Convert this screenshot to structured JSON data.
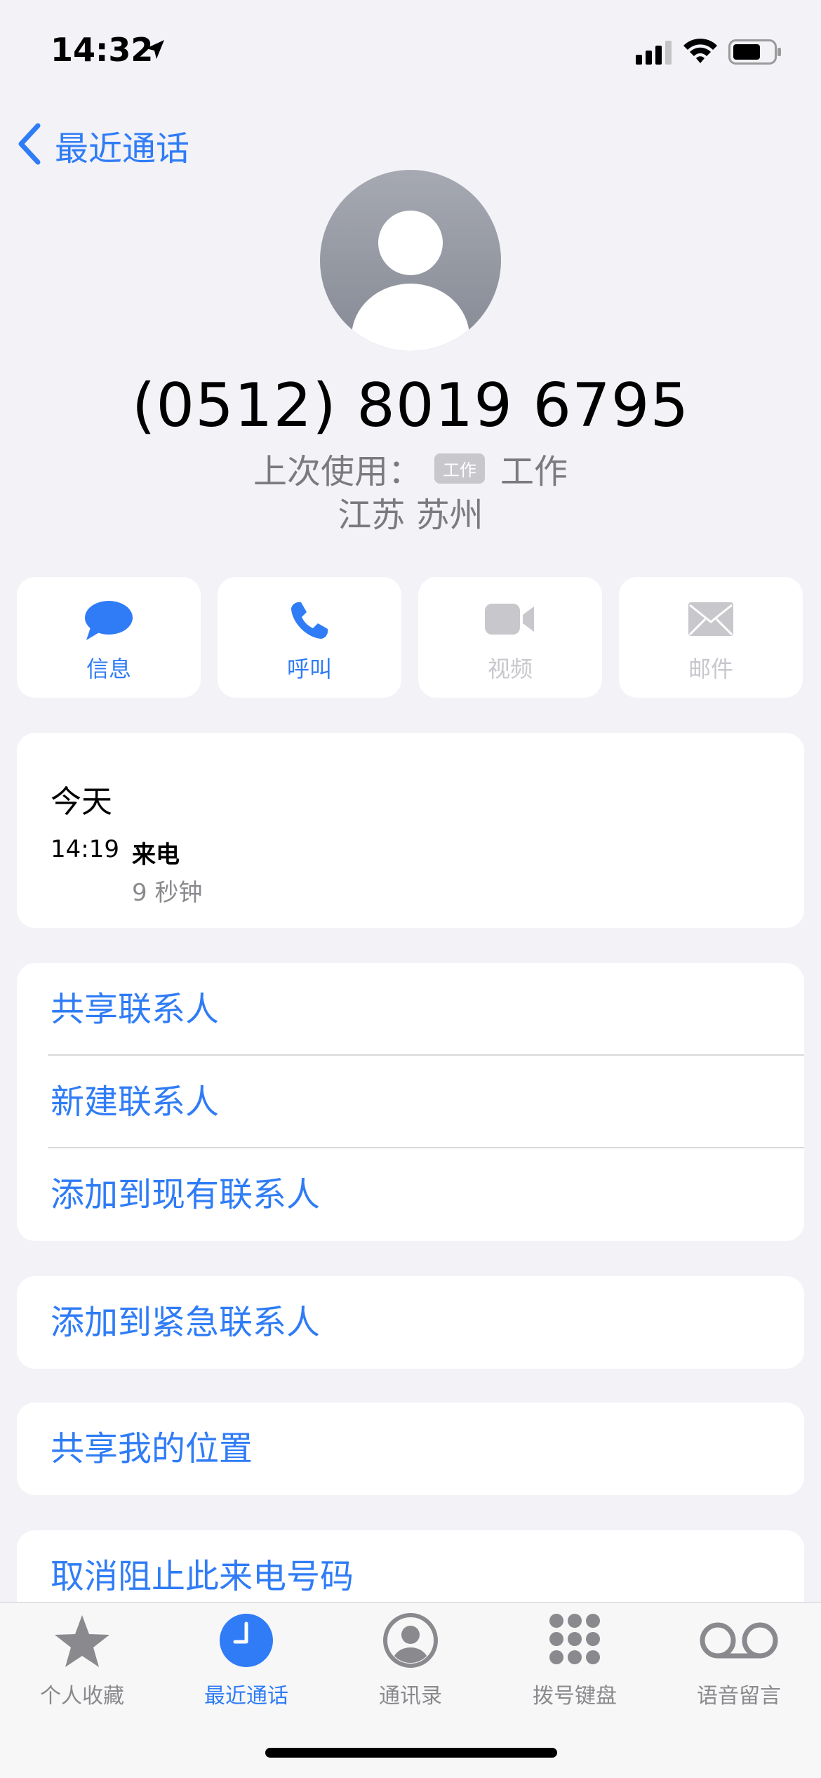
{
  "status_bar": {
    "time": "14:32",
    "icons": [
      "location-arrow-icon",
      "signal-icon",
      "wifi-icon",
      "battery-icon"
    ]
  },
  "nav": {
    "back_label": "最近通话"
  },
  "caller": {
    "number": "(0512) 8019 6795",
    "last_used_prefix": "上次使用：",
    "badge": "工作",
    "last_used_value": "工作",
    "location": "江苏 苏州"
  },
  "actions": [
    {
      "label": "信息",
      "icon": "message-icon",
      "enabled": true
    },
    {
      "label": "呼叫",
      "icon": "phone-icon",
      "enabled": true
    },
    {
      "label": "视频",
      "icon": "video-icon",
      "enabled": false
    },
    {
      "label": "邮件",
      "icon": "mail-icon",
      "enabled": false
    }
  ],
  "call_history": {
    "day": "今天",
    "time": "14:19",
    "type": "来电",
    "duration": "9 秒钟"
  },
  "contact_actions": [
    "共享联系人",
    "新建联系人",
    "添加到现有联系人"
  ],
  "emergency_action": "添加到紧急联系人",
  "location_action": "共享我的位置",
  "block_action": "取消阻止此来电号码",
  "tabs": [
    {
      "label": "个人收藏",
      "icon": "star-icon",
      "active": false
    },
    {
      "label": "最近通话",
      "icon": "clock-icon",
      "active": true
    },
    {
      "label": "通讯录",
      "icon": "person-circle-icon",
      "active": false
    },
    {
      "label": "拨号键盘",
      "icon": "keypad-icon",
      "active": false
    },
    {
      "label": "语音留言",
      "icon": "voicemail-icon",
      "active": false
    }
  ],
  "colors": {
    "accent": "#2f7cf6",
    "background": "#f2f2f7",
    "secondary_text": "#8a8a8e",
    "disabled": "#c7c7cc"
  }
}
